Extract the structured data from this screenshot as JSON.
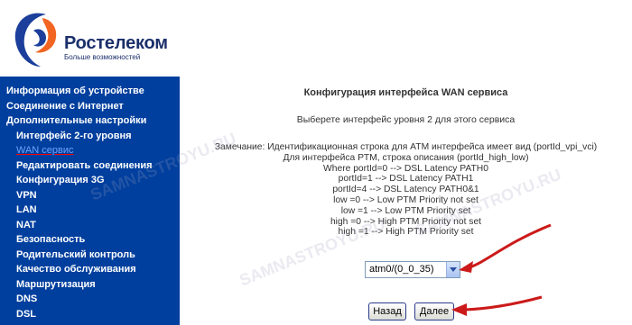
{
  "header": {
    "brand_name": "Ростелеком",
    "brand_slogan": "Больше возможностей",
    "brand_color": "#1b2f6b",
    "accent_color": "#f26522"
  },
  "sidebar": {
    "background": "#003f9e",
    "items": [
      {
        "label": "Информация об устройстве",
        "level": "top"
      },
      {
        "label": "Соединение с Интернет",
        "level": "top"
      },
      {
        "label": "Дополнительные настройки",
        "level": "top"
      },
      {
        "label": "Интерфейс 2-го уровня",
        "level": "sub"
      },
      {
        "label": "WAN сервис",
        "level": "sub",
        "active": true
      },
      {
        "label": "Редактировать соединения",
        "level": "sub"
      },
      {
        "label": "Конфигурация 3G",
        "level": "sub"
      },
      {
        "label": "VPN",
        "level": "sub"
      },
      {
        "label": "LAN",
        "level": "sub"
      },
      {
        "label": "NAT",
        "level": "sub"
      },
      {
        "label": "Безопасность",
        "level": "sub"
      },
      {
        "label": "Родительский контроль",
        "level": "sub"
      },
      {
        "label": "Качество обслуживания",
        "level": "sub"
      },
      {
        "label": "Маршрутизация",
        "level": "sub"
      },
      {
        "label": "DNS",
        "level": "sub"
      },
      {
        "label": "DSL",
        "level": "sub"
      }
    ]
  },
  "content": {
    "title": "Конфигурация интерфейса WAN сервиса",
    "subtitle": "Выберете интерфейс уровня 2 для этого сервиса",
    "notes": [
      "Замечание: Идентификационная строка для ATM интерфейса имеет вид (portId_vpi_vci)",
      "Для интерфейса PTM, строка описания (portId_high_low)",
      "Where portId=0 --> DSL Latency PATH0",
      "portId=1 --> DSL Latency PATH1",
      "portId=4 --> DSL Latency PATH0&1",
      "low =0 --> Low PTM Priority not set",
      "low =1 --> Low PTM Priority set",
      "high =0 --> High PTM Priority not set",
      "high =1 --> High PTM Priority set"
    ],
    "interface_select": {
      "selected": "atm0/(0_0_35)"
    },
    "buttons": {
      "back": "Назад",
      "next": "Далее"
    }
  },
  "watermark": "SAMNASTROYU.RU",
  "annotation_color": "#cc1a1a"
}
